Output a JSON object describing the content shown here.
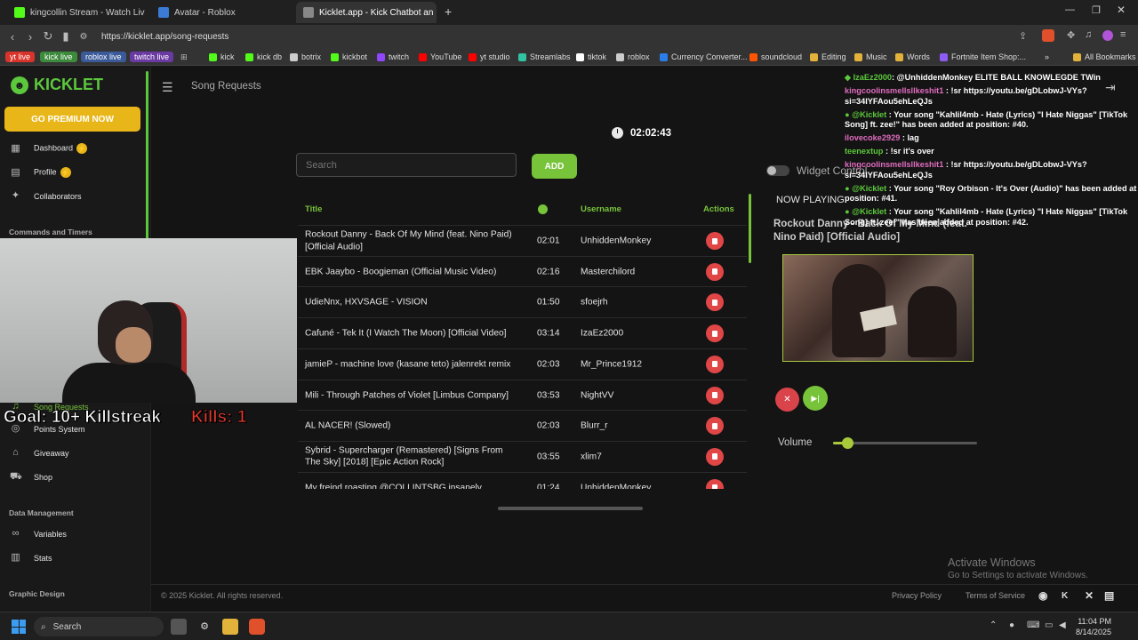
{
  "browser": {
    "tabs": [
      {
        "label": "kingcollin Stream - Watch Live on Ki",
        "favicon_color": "#53fc18"
      },
      {
        "label": "Avatar - Roblox",
        "favicon_color": "#3b7bd6"
      },
      {
        "label": "Kicklet.app - Kick Chatbot an",
        "favicon_color": "#888888"
      }
    ],
    "new_tab_glyph": "+",
    "url": "https://kicklet.app/song-requests",
    "bookmarks": [
      {
        "label": "yt live",
        "style": "pill",
        "color": "#d9342b"
      },
      {
        "label": "kick live",
        "style": "pill",
        "color": "#3c8a3c"
      },
      {
        "label": "roblox live",
        "style": "pill",
        "color": "#3a5a9a"
      },
      {
        "label": "twitch live",
        "style": "pill",
        "color": "#6a3aa2"
      },
      {
        "label": "kick",
        "color": "#53fc18"
      },
      {
        "label": "kick db",
        "color": "#53fc18"
      },
      {
        "label": "botrix",
        "color": "#cccccc"
      },
      {
        "label": "kickbot",
        "color": "#53fc18"
      },
      {
        "label": "twitch",
        "color": "#9146ff"
      },
      {
        "label": "YouTube",
        "color": "#ff0000"
      },
      {
        "label": "yt studio",
        "color": "#ff0000"
      },
      {
        "label": "Streamlabs",
        "color": "#31c3a2"
      },
      {
        "label": "tiktok",
        "color": "#ffffff"
      },
      {
        "label": "roblox",
        "color": "#cccccc"
      },
      {
        "label": "Currency Converter...",
        "color": "#2b7de9"
      },
      {
        "label": "soundcloud",
        "color": "#ff5500"
      },
      {
        "label": "Editing",
        "color": "#e2b23a"
      },
      {
        "label": "Music",
        "color": "#e2b23a"
      },
      {
        "label": "Words",
        "color": "#e2b23a"
      },
      {
        "label": "Fortnite Item Shop:...",
        "color": "#8c5cf5"
      }
    ],
    "more_glyph": "»",
    "all_bookmarks": "All Bookmarks"
  },
  "sidebar": {
    "brand": "KICKLET",
    "premium_button": "GO PREMIUM NOW",
    "items": [
      {
        "label": "Dashboard",
        "icon": "grid-icon",
        "glyph": "▦",
        "star": true
      },
      {
        "label": "Profile",
        "icon": "profile-icon",
        "glyph": "▤",
        "star": true
      },
      {
        "label": "Collaborators",
        "icon": "collaborators-icon",
        "glyph": "✦",
        "star": false
      }
    ],
    "section_commands": "Commands and Timers",
    "active_item": "Song Requests",
    "lower_items": [
      {
        "label": "Points System",
        "icon": "points-icon",
        "glyph": "◎"
      },
      {
        "label": "Giveaway",
        "icon": "gift-icon",
        "glyph": "⌂"
      },
      {
        "label": "Shop",
        "icon": "cart-icon",
        "glyph": "⛟"
      }
    ],
    "section_data": "Data Management",
    "data_items": [
      {
        "label": "Variables",
        "icon": "link-icon",
        "glyph": "∞"
      },
      {
        "label": "Stats",
        "icon": "chart-icon",
        "glyph": "▥"
      }
    ],
    "section_graphic": "Graphic Design"
  },
  "main": {
    "page_title": "Song Requests",
    "timer": "02:02:43",
    "search_placeholder": "Search",
    "add_button": "ADD",
    "columns": {
      "title": "Title",
      "username": "Username",
      "actions": "Actions"
    },
    "rows": [
      {
        "title": "Rockout Danny - Back Of My Mind (feat. Nino Paid) [Official Audio]",
        "duration": "02:01",
        "username": "UnhiddenMonkey"
      },
      {
        "title": "EBK Jaaybo - Boogieman (Official Music Video)",
        "duration": "02:16",
        "username": "Masterchilord"
      },
      {
        "title": "UdieNnx, HXVSAGE - VISION",
        "duration": "01:50",
        "username": "sfoejrh"
      },
      {
        "title": "Cafuné - Tek It (I Watch The Moon) [Official Video]",
        "duration": "03:14",
        "username": "IzaEz2000"
      },
      {
        "title": "jamieP - machine love (kasane teto) jalenrekt remix",
        "duration": "02:03",
        "username": "Mr_Prince1912"
      },
      {
        "title": "Mili - Through Patches of Violet [Limbus Company]",
        "duration": "03:53",
        "username": "NightVV"
      },
      {
        "title": "AL NACER! (Slowed)",
        "duration": "02:03",
        "username": "Blurr_r"
      },
      {
        "title": "Sybrid - Supercharger (Remastered) [Signs From The Sky] [2018] [Epic Action Rock]",
        "duration": "03:55",
        "username": "xlim7"
      },
      {
        "title": "My freind roasting @COLLINTSBG insanely",
        "duration": "01:24",
        "username": "UnhiddenMonkey"
      }
    ]
  },
  "player": {
    "widget_control": "Widget Control",
    "now_playing_label": "NOW PLAYING:",
    "now_playing_title": "Rockout Danny - Back Of My Mind (feat. Nino Paid) [Official Audio]",
    "stop_glyph": "✕",
    "skip_glyph": "▶|",
    "volume_label": "Volume",
    "volume_level": 0.1
  },
  "chat": [
    {
      "user": "IzaEz2000",
      "user_class": "cn-green",
      "prefix": "◆ ",
      "text": ": @UnhiddenMonkey ELITE BALL KNOWLEGDE TWin"
    },
    {
      "user": "kingcoolinsmellsllkeshit1",
      "user_class": "cn-user",
      "prefix": "",
      "text": " : !sr https://youtu.be/gDLobwJ-VYs?si=34IYFAou5ehLeQJs"
    },
    {
      "user": "@Kicklet",
      "user_class": "cn-bot",
      "prefix": "● ",
      "text": " : Your song \"Kahlil4mb - Hate (Lyrics) \"I Hate Niggas\" [TikTok Song] ft. zee!\" has been added at position: #40."
    },
    {
      "user": "ilovecoke2929",
      "user_class": "cn-user",
      "prefix": "",
      "text": " : lag"
    },
    {
      "user": "teenextup",
      "user_class": "cn-green",
      "prefix": "",
      "text": " : !sr it's over"
    },
    {
      "user": "kingcoolinsmellsllkeshit1",
      "user_class": "cn-user",
      "prefix": "",
      "text": " : !sr https://youtu.be/gDLobwJ-VYs?si=34IYFAou5ehLeQJs"
    },
    {
      "user": "@Kicklet",
      "user_class": "cn-bot",
      "prefix": "● ",
      "text": " : Your song \"Roy Orbison - It's Over (Audio)\" has been added at position: #41."
    },
    {
      "user": "@Kicklet",
      "user_class": "cn-bot",
      "prefix": "● ",
      "text": " : Your song \"Kahlil4mb - Hate (Lyrics) \"I Hate Niggas\" [TikTok Song] ft. zee!\" has been added at position: #42."
    }
  ],
  "overlay": {
    "goal": "Goal: 10+ Killstreak",
    "kills": "Kills: 1"
  },
  "footer": {
    "copyright": "© 2025 Kicklet. All rights reserved.",
    "privacy": "Privacy Policy",
    "terms": "Terms of Service",
    "activate_title": "Activate Windows",
    "activate_sub": "Go to Settings to activate Windows."
  },
  "taskbar": {
    "search": "Search",
    "time": "11:04 PM",
    "date": "8/14/2025"
  }
}
